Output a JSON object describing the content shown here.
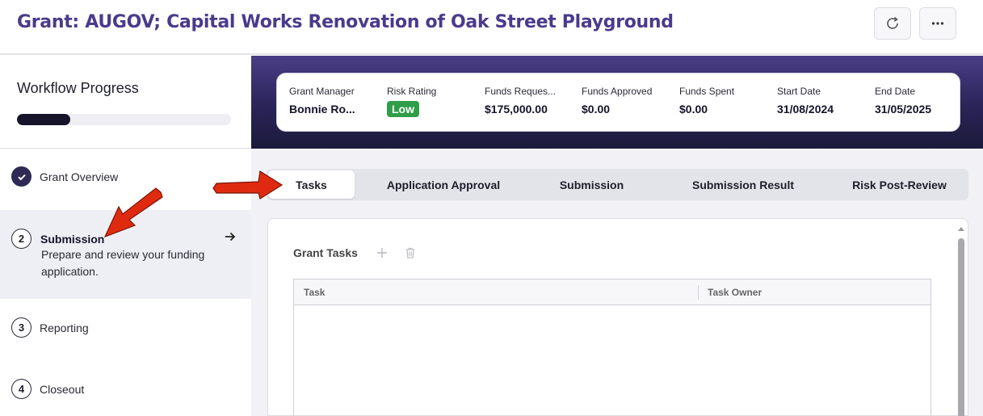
{
  "header": {
    "title": "Grant: AUGOV; Capital Works Renovation of Oak Street Playground",
    "refresh_icon": "refresh-icon",
    "more_icon": "more-horizontal-icon"
  },
  "sidebar": {
    "title": "Workflow Progress",
    "progress": 0.25,
    "steps": [
      {
        "number": "",
        "label": "Grant Overview",
        "status": "complete",
        "icon": "check-icon"
      },
      {
        "number": "2",
        "label": "Submission",
        "description": "Prepare and review your funding application.",
        "status": "active",
        "icon": "arrow-right-icon"
      },
      {
        "number": "3",
        "label": "Reporting",
        "status": "pending"
      },
      {
        "number": "4",
        "label": "Closeout",
        "status": "pending"
      }
    ]
  },
  "summary": {
    "grant_manager": {
      "label": "Grant Manager",
      "value": "Bonnie Ro..."
    },
    "risk_rating": {
      "label": "Risk Rating",
      "value": "Low"
    },
    "funds_requested": {
      "label": "Funds Reques...",
      "value": "$175,000.00"
    },
    "funds_approved": {
      "label": "Funds Approved",
      "value": "$0.00"
    },
    "funds_spent": {
      "label": "Funds Spent",
      "value": "$0.00"
    },
    "start_date": {
      "label": "Start Date",
      "value": "31/08/2024"
    },
    "end_date": {
      "label": "End Date",
      "value": "31/05/2025"
    }
  },
  "tabs": [
    {
      "label": "Tasks",
      "active": true
    },
    {
      "label": "Application Approval",
      "active": false
    },
    {
      "label": "Submission",
      "active": false
    },
    {
      "label": "Submission Result",
      "active": false
    },
    {
      "label": "Risk Post-Review",
      "active": false
    }
  ],
  "grant_tasks": {
    "title": "Grant Tasks",
    "columns": [
      "Task",
      "Task Owner"
    ],
    "rows": []
  },
  "colors": {
    "brand": "#4b3a8c",
    "banner_dark": "#1b1a3a",
    "badge_low": "#2e9e48",
    "annotation": "#e02a10"
  }
}
